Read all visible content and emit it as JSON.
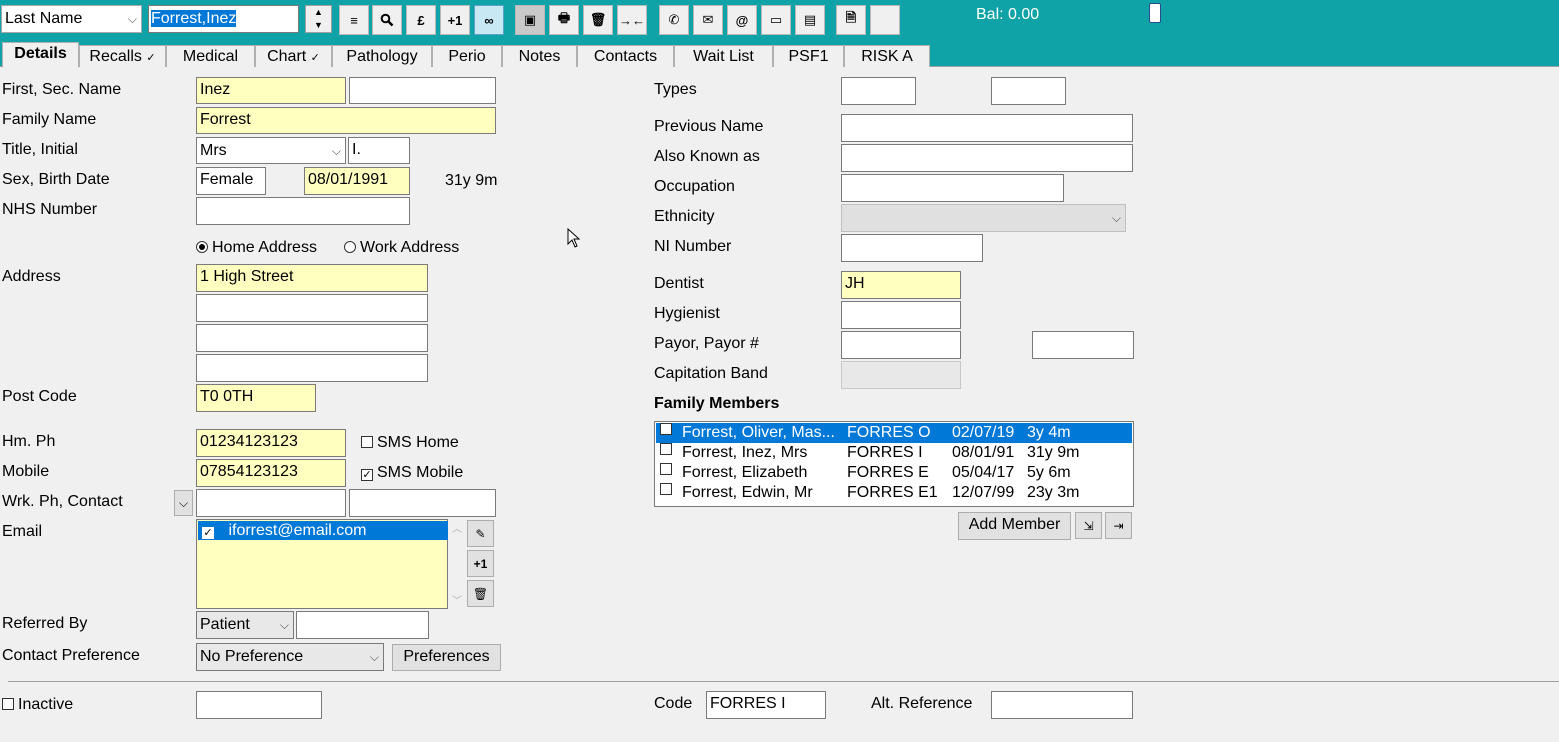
{
  "toolbar": {
    "search_field": "Last Name",
    "search_value": "Forrest,Inez",
    "balance": "Bal: 0.00",
    "plus_one": "+1",
    "pound": "£"
  },
  "tabs": [
    "Details",
    "Recalls",
    "Medical",
    "Chart",
    "Pathology",
    "Perio",
    "Notes",
    "Contacts",
    "Wait List",
    "PSF1",
    "RISK A"
  ],
  "tab_marks": {
    "recalls": "✓",
    "chart": "✓"
  },
  "left": {
    "first_sec_label": "First, Sec. Name",
    "first_name": "Inez",
    "second_name": "",
    "family_label": "Family Name",
    "family_name": "Forrest",
    "title_label": "Title, Initial",
    "title": "Mrs",
    "initial": "I.",
    "sex_dob_label": "Sex, Birth Date",
    "sex": "Female",
    "birth_date": "08/01/1991",
    "age": "31y 9m",
    "nhs_label": "NHS Number",
    "nhs_number": "",
    "home_address": "Home Address",
    "work_address": "Work Address",
    "address_label": "Address",
    "address": [
      "1 High Street",
      "",
      "",
      ""
    ],
    "postcode_label": "Post Code",
    "postcode": "T0 0TH",
    "home_phone_label": "Hm. Ph",
    "home_phone": "01234123123",
    "sms_home": "SMS Home",
    "mobile_label": "Mobile",
    "mobile": "07854123123",
    "sms_mobile": "SMS Mobile",
    "work_phone_label": "Wrk. Ph, Contact",
    "work_phone": "",
    "work_contact": "",
    "email_label": "Email",
    "email": "iforrest@email.com",
    "referred_label": "Referred By",
    "referred_by": "Patient",
    "referred_detail": "",
    "contact_pref_label": "Contact Preference",
    "contact_pref": "No Preference",
    "preferences_button": "Preferences"
  },
  "right": {
    "types_label": "Types",
    "previous_name_label": "Previous Name",
    "also_known_label": "Also Known as",
    "occupation_label": "Occupation",
    "ethnicity_label": "Ethnicity",
    "ni_label": "NI Number",
    "dentist_label": "Dentist",
    "dentist": "JH",
    "hygienist_label": "Hygienist",
    "payor_label": "Payor, Payor #",
    "capitation_label": "Capitation Band",
    "family_members_label": "Family Members",
    "add_member": "Add Member"
  },
  "family_members": [
    {
      "name": "Forrest, Oliver, Mas...",
      "code": "FORRES O",
      "dob": "02/07/19",
      "age": "3y 4m"
    },
    {
      "name": "Forrest, Inez, Mrs",
      "code": "FORRES I",
      "dob": "08/01/91",
      "age": "31y 9m"
    },
    {
      "name": "Forrest, Elizabeth",
      "code": "FORRES E",
      "dob": "05/04/17",
      "age": "5y 6m"
    },
    {
      "name": "Forrest, Edwin, Mr",
      "code": "FORRES E1",
      "dob": "12/07/99",
      "age": "23y 3m"
    }
  ],
  "footer": {
    "inactive": "Inactive",
    "code_label": "Code",
    "code": "FORRES I",
    "alt_ref_label": "Alt. Reference"
  },
  "colors": {
    "teal": "#0fa3a8",
    "highlight": "#0078d7",
    "field_yellow": "#ffffc0"
  }
}
